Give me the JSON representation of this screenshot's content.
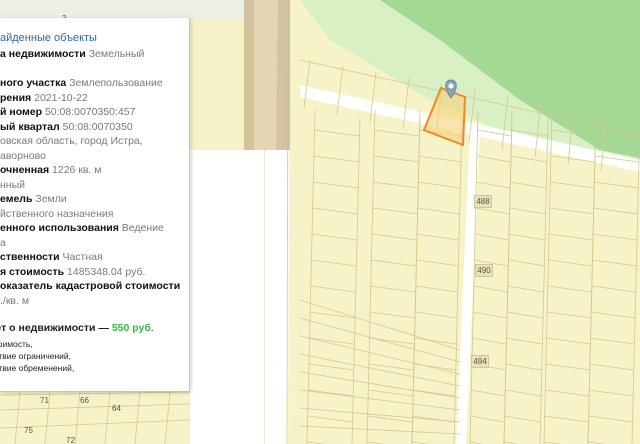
{
  "panel": {
    "header": "айденные объекты",
    "rows": [
      {
        "label": "а недвижимости",
        "value": "Земельный"
      },
      {
        "label": "",
        "value": ""
      },
      {
        "label": "ного участка",
        "value": "Землепользование"
      },
      {
        "label": "рения",
        "value": "2021-10-22"
      },
      {
        "label": "й номер",
        "value": "50:08:0070350:457"
      },
      {
        "label": "ый квартал",
        "value": "50:08:0070350"
      },
      {
        "label": "",
        "value": "овская область, город Истра,"
      },
      {
        "label": "",
        "value": "аворново"
      },
      {
        "label": "очненная",
        "value": "1226 кв. м"
      },
      {
        "label": "",
        "value": "нный"
      },
      {
        "label": "емель",
        "value": "Земли"
      },
      {
        "label": "",
        "value": "йственного назначения"
      },
      {
        "label": "енного использования",
        "value": "Ведение"
      },
      {
        "label": "",
        "value": "а"
      },
      {
        "label": "ственности",
        "value": "Частная"
      },
      {
        "label": "я стоимость",
        "value": "1485348.04 руб."
      },
      {
        "label": "оказатель кадастровой стоимости",
        "value": ""
      },
      {
        "label": "",
        "value": "./кв. м"
      }
    ],
    "report_label": "отчет о недвижимости —",
    "report_price": "550 руб.",
    "bullets": [
      "ая стоимость,",
      "тсутствие ограничений,",
      "тсутствие обременений,"
    ]
  },
  "map": {
    "plot_labels": [
      {
        "text": "3",
        "key": "p3"
      },
      {
        "text": "71",
        "key": "p71"
      },
      {
        "text": "66",
        "key": "p66"
      },
      {
        "text": "64",
        "key": "p64"
      },
      {
        "text": "75",
        "key": "p75"
      },
      {
        "text": "72",
        "key": "p72"
      }
    ],
    "badges": [
      "488",
      "490",
      "494"
    ],
    "colors": {
      "base": "#f7f3c9",
      "forest": "#9fd890",
      "forest_light": "#d9efc4",
      "road": "#ffffff",
      "highlight": "#f0882a"
    },
    "marker_icon": "map-pin-icon"
  }
}
